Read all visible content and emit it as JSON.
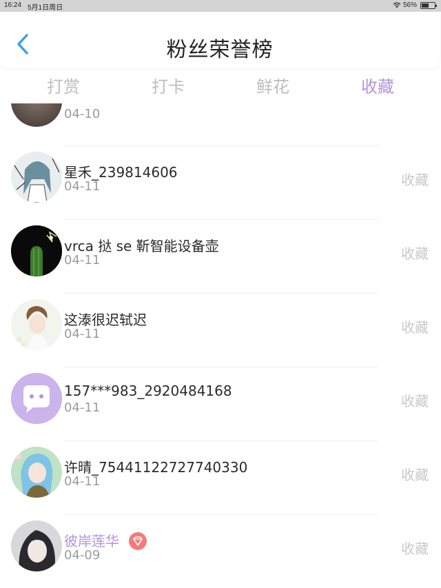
{
  "status_bar": {
    "time": "16:24",
    "date": "5月1日周日",
    "battery": "56%",
    "battery_level": 0.56
  },
  "header": {
    "title": "粉丝荣誉榜"
  },
  "tabs": [
    {
      "label": "打赏",
      "active": false
    },
    {
      "label": "打卡",
      "active": false
    },
    {
      "label": "鲜花",
      "active": false
    },
    {
      "label": "收藏",
      "active": true
    }
  ],
  "list": [
    {
      "name": "",
      "date": "04-10",
      "action": ""
    },
    {
      "name": "星禾_239814606",
      "date": "04-11",
      "action": "收藏"
    },
    {
      "name": "vrca 挞 se 靳智能设备壶",
      "date": "04-11",
      "action": "收藏"
    },
    {
      "name": "这溙很迟轼迟",
      "date": "04-11",
      "action": "收藏"
    },
    {
      "name": "157***983_2920484168",
      "date": "04-11",
      "action": "收藏"
    },
    {
      "name": "许晴_75441122727740330",
      "date": "04-11",
      "action": "收藏"
    },
    {
      "name": "彼岸莲华",
      "date": "04-09",
      "action": "收藏"
    }
  ],
  "colors": {
    "accent": "#b394dc",
    "tab_inactive": "#bdbdbd",
    "back_icon": "#3aa0e8",
    "vip_badge": "#f47b7b"
  }
}
